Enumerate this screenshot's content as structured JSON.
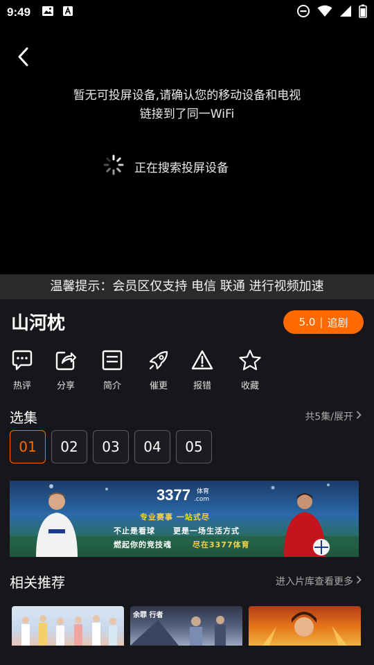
{
  "status_bar": {
    "time": "9:49"
  },
  "player": {
    "cast_message_line1": "暂无可投屏设备,请确认您的移动设备和电视",
    "cast_message_line2": "链接到了同一WiFi",
    "searching_text": "正在搜索投屏设备"
  },
  "notice": {
    "text": "温馨提示：会员区仅支持 电信 联通 进行视频加速"
  },
  "show": {
    "title": "山河枕",
    "rating": "5.0",
    "follow_label": "追剧"
  },
  "actions": [
    {
      "label": "热评",
      "icon": "comment-icon"
    },
    {
      "label": "分享",
      "icon": "share-icon"
    },
    {
      "label": "简介",
      "icon": "intro-icon"
    },
    {
      "label": "催更",
      "icon": "rocket-icon"
    },
    {
      "label": "报错",
      "icon": "warning-icon"
    },
    {
      "label": "收藏",
      "icon": "star-icon"
    }
  ],
  "episodes": {
    "title": "选集",
    "more_label": "共5集/展开",
    "items": [
      "01",
      "02",
      "03",
      "04",
      "05"
    ],
    "active_index": 0
  },
  "ad": {
    "brand": "3377",
    "brand_sub": "体育",
    "brand_com": ".com",
    "line1": "专业赛事 一站式尽",
    "line2a": "不止是看球",
    "line2b": "更是一场生活方式",
    "line3a": "燃起你的竞技魂",
    "line3b": "尽在3377体育",
    "accent_color": "#f7d34a"
  },
  "recommend": {
    "title": "相关推荐",
    "more_label": "进入片库查看更多",
    "thumb2_caption": "余罪 行者"
  },
  "colors": {
    "accent": "#ff6a00",
    "background": "#17171b",
    "notice_bg": "#2a2a2d"
  }
}
